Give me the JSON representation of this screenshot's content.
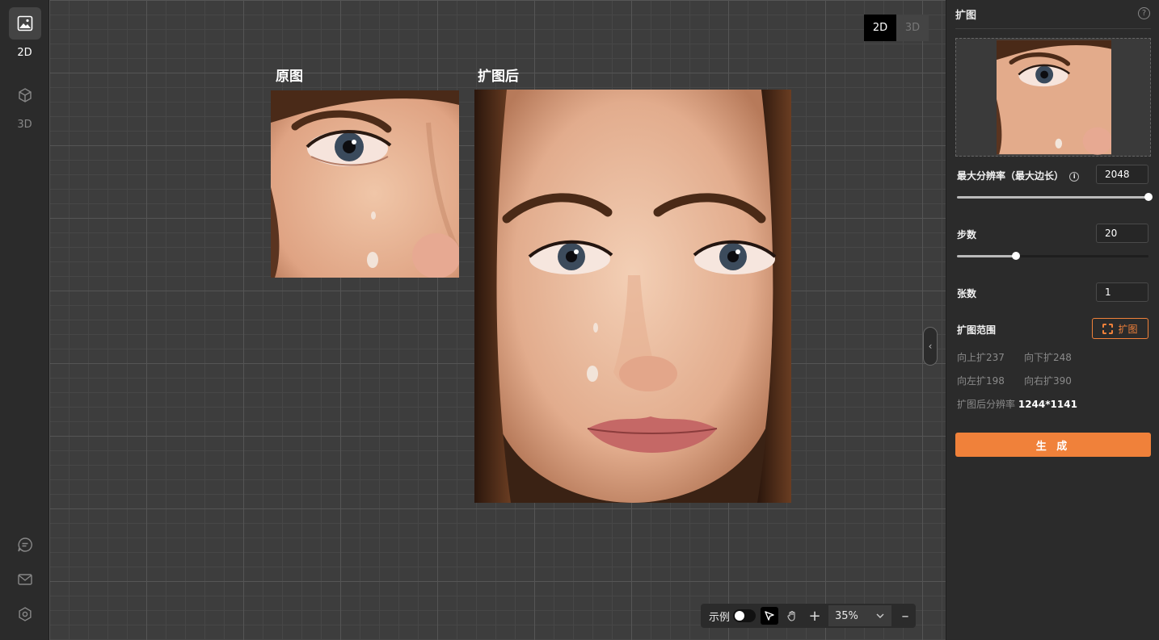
{
  "leftbar": {
    "items": [
      {
        "label": "2D",
        "icon": "image-icon"
      },
      {
        "label": "3D",
        "icon": "cube-icon"
      }
    ],
    "bottom_icons": [
      "chat-icon",
      "mail-icon",
      "settings-icon"
    ]
  },
  "canvas": {
    "mode_toggle": {
      "on": "2D",
      "off": "3D"
    },
    "original_title": "原图",
    "expanded_title": "扩图后"
  },
  "toolbar": {
    "example_label": "示例",
    "zoom": "35%"
  },
  "panel": {
    "title": "扩图",
    "max_resolution_label": "最大分辨率（最大边长）",
    "max_resolution_value": "2048",
    "max_resolution_fraction": 1.0,
    "steps_label": "步数",
    "steps_value": "20",
    "steps_fraction": 0.31,
    "count_label": "张数",
    "count_value": "1",
    "range_label": "扩图范围",
    "range_button": "扩图",
    "expand_up": "向上扩237",
    "expand_down": "向下扩248",
    "expand_left": "向左扩198",
    "expand_right": "向右扩390",
    "result_res_label": "扩图后分辨率",
    "result_res_value": "1244*1141",
    "generate_button": "生 成"
  },
  "colors": {
    "accent": "#f0813a",
    "panel_bg": "#2b2b2b",
    "canvas_bg": "#3d3d3d"
  }
}
